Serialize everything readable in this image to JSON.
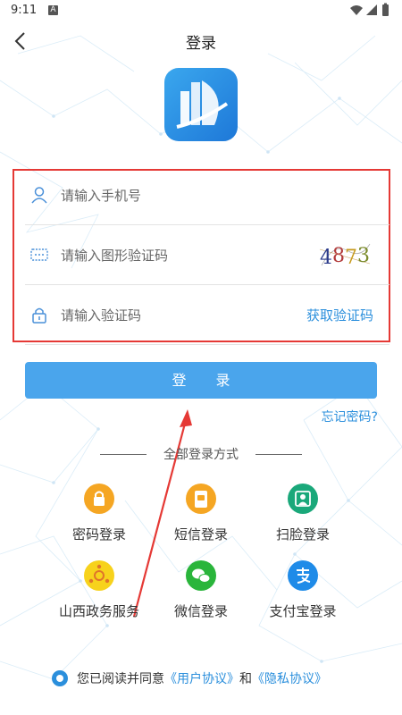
{
  "status_bar": {
    "time": "9:11",
    "notification_badge": "A"
  },
  "nav": {
    "title": "登录"
  },
  "form": {
    "phone_placeholder": "请输入手机号",
    "captcha_placeholder": "请输入图形验证码",
    "captcha_digits": [
      "4",
      "8",
      "7",
      "3"
    ],
    "code_placeholder": "请输入验证码",
    "get_code_label": "获取验证码"
  },
  "login_button": "登 录",
  "forgot_password": "忘记密码?",
  "divider_text": "全部登录方式",
  "methods": [
    {
      "label": "密码登录",
      "icon": "lock-icon",
      "color": "#f5a623"
    },
    {
      "label": "短信登录",
      "icon": "sms-icon",
      "color": "#f5a623"
    },
    {
      "label": "扫脸登录",
      "icon": "face-scan-icon",
      "color": "#1aa87a"
    },
    {
      "label": "山西政务服务",
      "icon": "gov-service-icon",
      "color": "#f7d21c"
    },
    {
      "label": "微信登录",
      "icon": "wechat-icon",
      "color": "#2ab53b"
    },
    {
      "label": "支付宝登录",
      "icon": "alipay-icon",
      "color": "#1f8be8"
    }
  ],
  "agreement": {
    "prefix": "您已阅读并同意",
    "user_agreement": "《用户协议》",
    "and": "和",
    "privacy_policy": "《隐私协议》"
  }
}
